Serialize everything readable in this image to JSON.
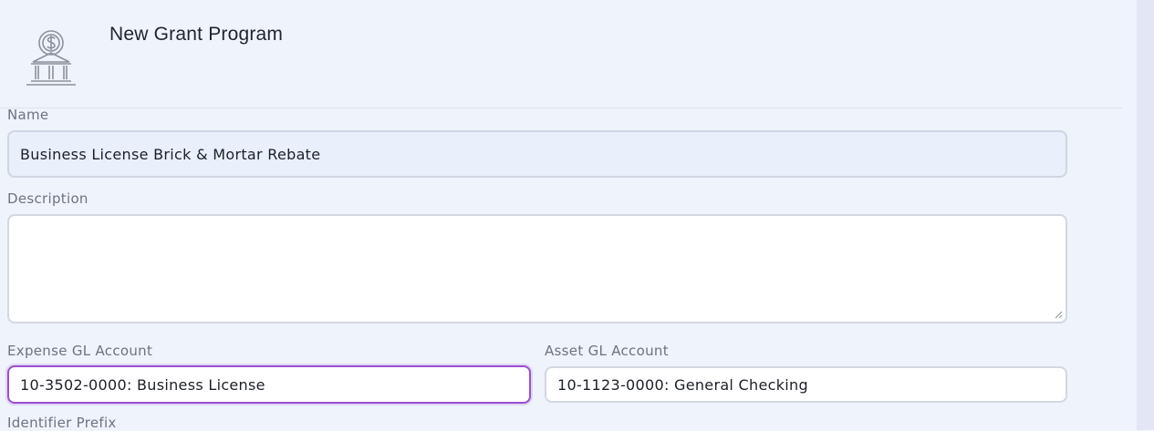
{
  "header": {
    "title": "New Grant Program",
    "icon": "bank-dollar-icon"
  },
  "form": {
    "name": {
      "label": "Name",
      "value": "Business License Brick & Mortar Rebate"
    },
    "description": {
      "label": "Description",
      "value": ""
    },
    "expense_gl_account": {
      "label": "Expense GL Account",
      "value": "10-3502-0000: Business License"
    },
    "asset_gl_account": {
      "label": "Asset GL Account",
      "value": "10-1123-0000: General Checking"
    },
    "identifier_prefix": {
      "label": "Identifier Prefix"
    }
  },
  "colors": {
    "background": "#eff3fb",
    "focus_border": "#9b4fd1",
    "filled_input": "#e9effb",
    "label": "#6c7380"
  }
}
